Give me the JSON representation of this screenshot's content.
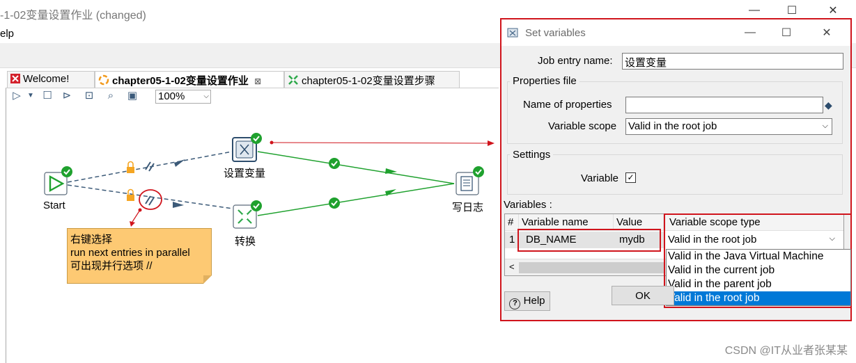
{
  "window": {
    "title": "-1-02变量设置作业 (changed)",
    "menu_help": "elp"
  },
  "tabs": [
    {
      "label": "Welcome!",
      "active": false
    },
    {
      "label": "chapter05-1-02变量设置作业",
      "active": true,
      "close": "⊠"
    },
    {
      "label": "chapter05-1-02变量设置步骤",
      "active": false
    }
  ],
  "toolbar": {
    "icons": [
      "run-icon",
      "dropdown-arrow-icon",
      "stop-icon",
      "preview-icon",
      "replay-icon",
      "sql-icon",
      "explore-icon"
    ],
    "zoom": "100%"
  },
  "flow": {
    "nodes": {
      "start": "Start",
      "set_variables": "设置变量",
      "transform": "转换",
      "write_log": "写日志"
    }
  },
  "note": {
    "lines": [
      "右键选择",
      "run next entries in parallel",
      "可出现并行选项 //"
    ]
  },
  "dialog": {
    "title": "Set variables",
    "job_entry_name_label": "Job entry name:",
    "job_entry_name_value": "设置变量",
    "properties_file_legend": "Properties file",
    "name_of_properties_label": "Name of properties",
    "name_of_properties_value": "",
    "variable_scope_label": "Variable scope",
    "variable_scope_value": "Valid in the root job",
    "settings_legend": "Settings",
    "variable_label": "Variable",
    "variable_checked": "✓",
    "variables_label": "Variables :",
    "grid": {
      "headers": [
        "#",
        "Variable name",
        "Value",
        "Variable scope type"
      ],
      "rows": [
        {
          "num": "1",
          "name": "DB_NAME",
          "value": "mydb",
          "scope": "Valid in the root job"
        }
      ]
    },
    "scope_options": [
      "Valid in the Java Virtual Machine",
      "Valid in the current job",
      "Valid in the parent job",
      "Valid in the root job"
    ],
    "selected_option_index": 3,
    "help_button": "Help",
    "ok_button": "OK"
  },
  "watermark": "CSDN @IT从业者张某某",
  "colors": {
    "accent_red": "#d0141c",
    "hop_green": "#1fa12e",
    "hop_blue": "#3c5a78",
    "note_yellow": "#fdc973",
    "selection_blue": "#0078d7"
  }
}
